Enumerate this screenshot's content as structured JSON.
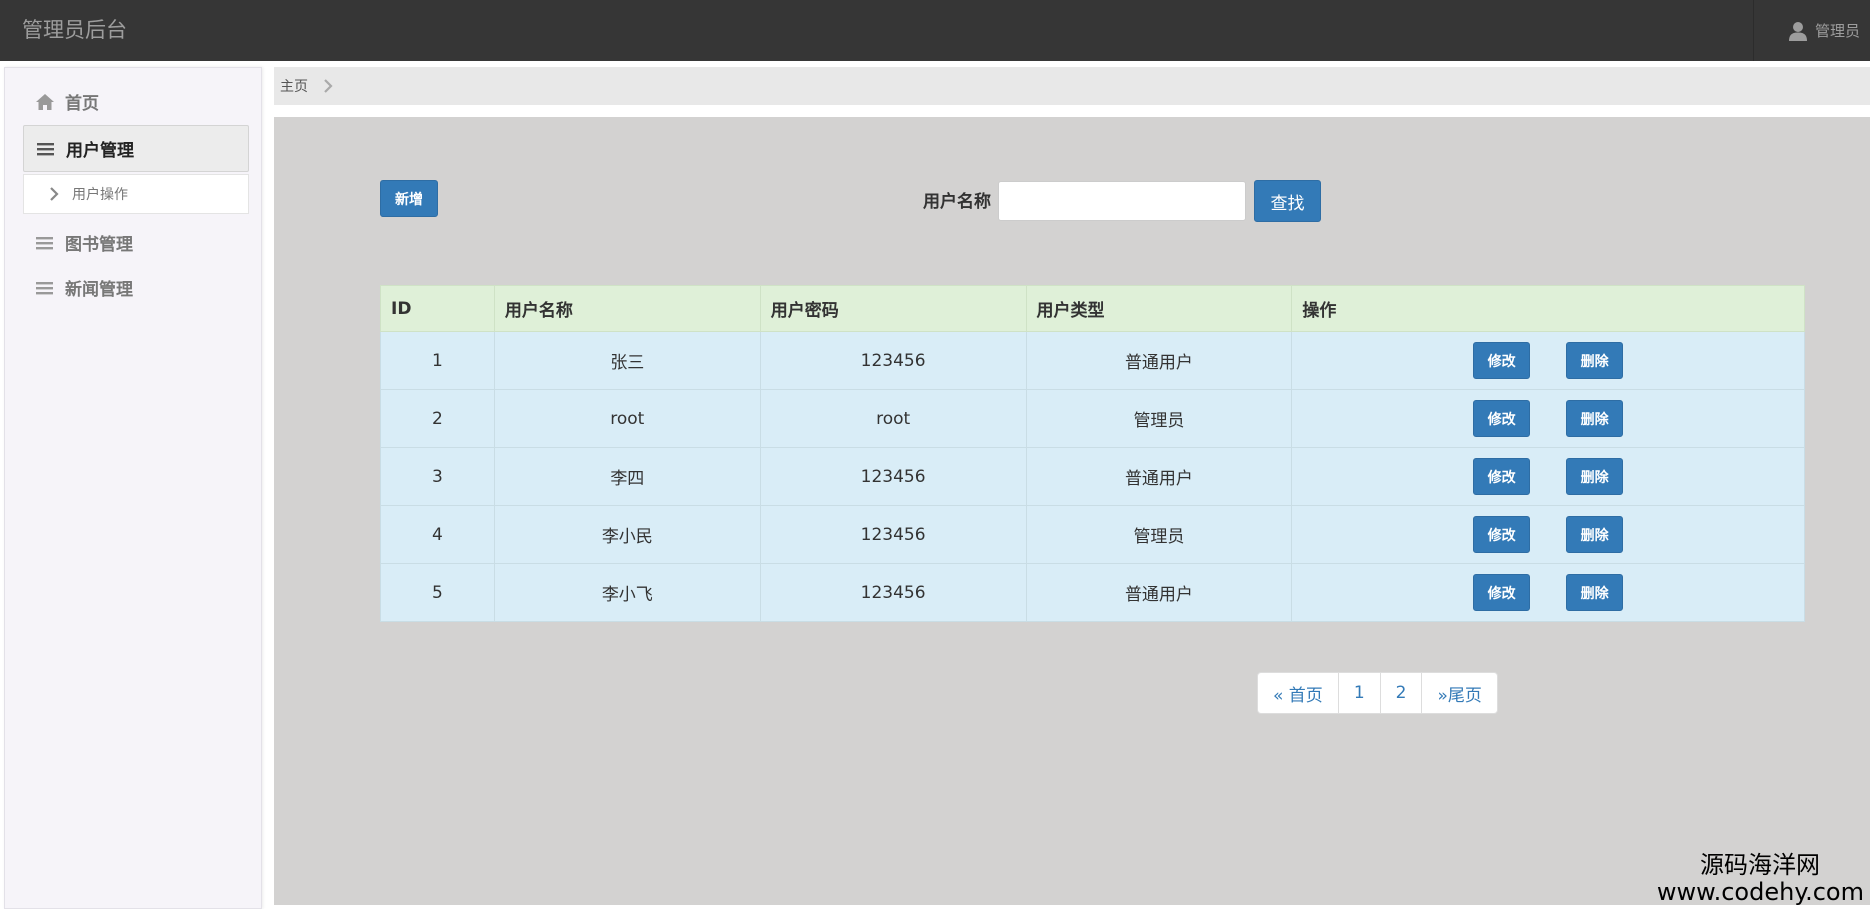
{
  "navbar": {
    "brand": "管理员后台",
    "user_label": "管理员"
  },
  "sidebar": {
    "items": [
      {
        "label": "首页",
        "icon": "home-icon"
      },
      {
        "label": "用户管理",
        "icon": "list-icon",
        "active": true
      },
      {
        "label": "图书管理",
        "icon": "list-icon"
      },
      {
        "label": "新闻管理",
        "icon": "list-icon"
      }
    ],
    "sub_item": {
      "label": "用户操作",
      "icon": "chevron-right-icon"
    }
  },
  "breadcrumb": {
    "home": "主页"
  },
  "toolbar": {
    "add_label": "新增",
    "search_label": "用户名称",
    "search_value": "",
    "search_button": "查找"
  },
  "table": {
    "headers": [
      "ID",
      "用户名称",
      "用户密码",
      "用户类型",
      "操作"
    ],
    "rows": [
      {
        "id": "1",
        "name": "张三",
        "password": "123456",
        "type": "普通用户"
      },
      {
        "id": "2",
        "name": "root",
        "password": "root",
        "type": "管理员"
      },
      {
        "id": "3",
        "name": "李四",
        "password": "123456",
        "type": "普通用户"
      },
      {
        "id": "4",
        "name": "李小民",
        "password": "123456",
        "type": "管理员"
      },
      {
        "id": "5",
        "name": "李小飞",
        "password": "123456",
        "type": "普通用户"
      }
    ],
    "edit_label": "修改",
    "delete_label": "删除"
  },
  "pagination": {
    "first": "« 首页",
    "pages": [
      "1",
      "2"
    ],
    "last": "»尾页"
  },
  "watermark": {
    "line1": "源码海洋网",
    "line2": "www.codehy.com"
  },
  "colors": {
    "navbar": "#363636",
    "primary": "#337ab7",
    "header_row": "#dff0d8",
    "body_row": "#d9edf7",
    "content_bg": "#d3d2d1"
  }
}
